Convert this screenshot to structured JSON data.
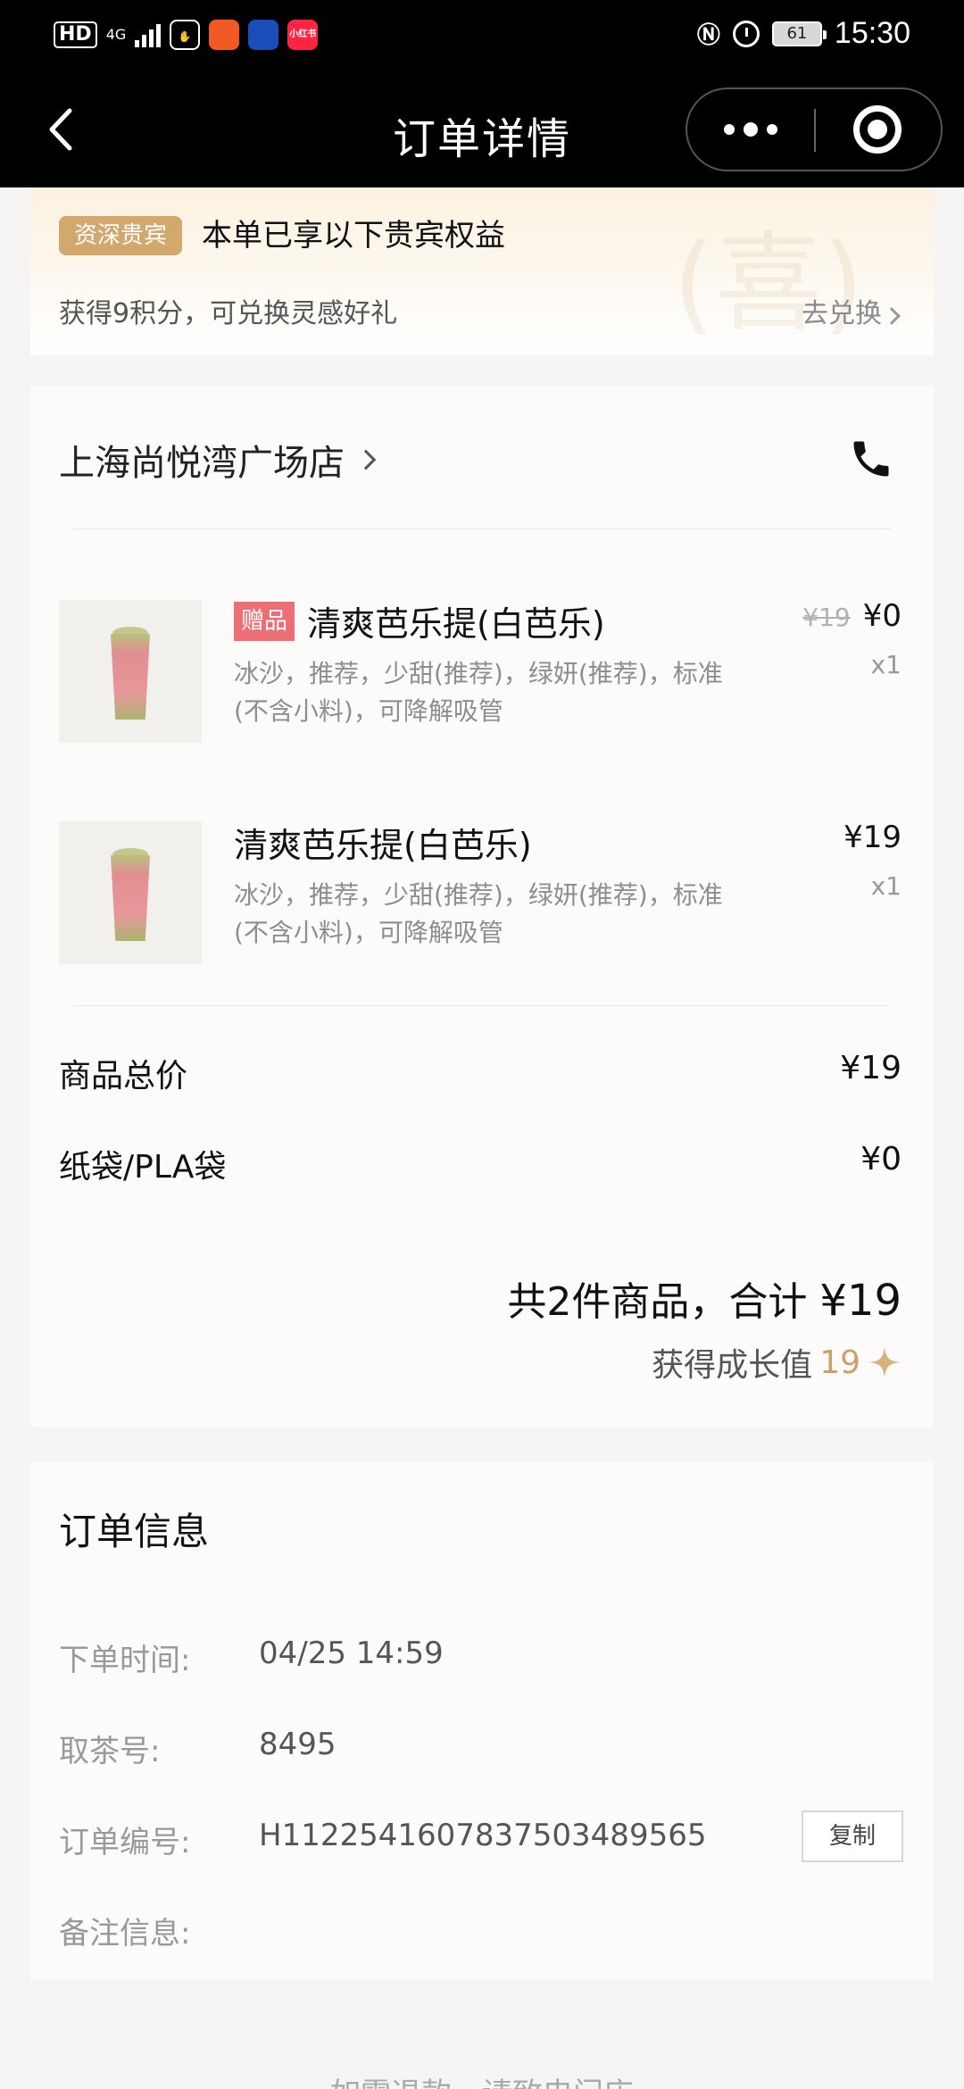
{
  "status_bar": {
    "hd": "HD",
    "signal_4g": "4G",
    "apps": [
      {
        "icon": "hand-app-icon",
        "color": "#ffffff"
      },
      {
        "icon": "red-app-icon",
        "color": "#f15a24"
      },
      {
        "icon": "promo-app-icon",
        "color": "#1a4db8"
      },
      {
        "icon": "xiaohongshu-app-icon",
        "label": "小红书",
        "color": "#ff2442"
      }
    ],
    "battery": "61",
    "time": "15:30"
  },
  "nav": {
    "title": "订单详情"
  },
  "vip": {
    "badge": "资深贵宾",
    "title": "本单已享以下贵宾权益",
    "subtitle": "获得9积分，可兑换灵感好礼",
    "link": "去兑换"
  },
  "store": {
    "name": "上海尚悦湾广场店",
    "items": [
      {
        "tag": "赠品",
        "name": "清爽芭乐提(白芭乐)",
        "desc": "冰沙，推荐，少甜(推荐)，绿妍(推荐)，标准(不含小料)，可降解吸管",
        "original_price": "¥19",
        "price": "¥0",
        "qty": "x1"
      },
      {
        "tag": "",
        "name": "清爽芭乐提(白芭乐)",
        "desc": "冰沙，推荐，少甜(推荐)，绿妍(推荐)，标准(不含小料)，可降解吸管",
        "original_price": "",
        "price": "¥19",
        "qty": "x1"
      }
    ],
    "subtotal_label": "商品总价",
    "subtotal_value": "¥19",
    "bag_label": "纸袋/PLA袋",
    "bag_value": "¥0",
    "total_prefix": "共2件商品，合计 ",
    "total_value": "¥19",
    "growth_label": "获得成长值 ",
    "growth_value": "19"
  },
  "order_info": {
    "title": "订单信息",
    "rows": [
      {
        "label": "下单时间:",
        "value": "04/25 14:59"
      },
      {
        "label": "取茶号:",
        "value": "8495"
      },
      {
        "label": "订单编号:",
        "value": "H1122541607837503489565"
      },
      {
        "label": "备注信息:",
        "value": ""
      }
    ],
    "copy_label": "复制"
  },
  "footer": {
    "text": "如需退款，请致电门店"
  },
  "colors": {
    "accent_gold": "#d2a86d",
    "gift_tag": "#ed6f76",
    "growth": "#c9a16a"
  }
}
